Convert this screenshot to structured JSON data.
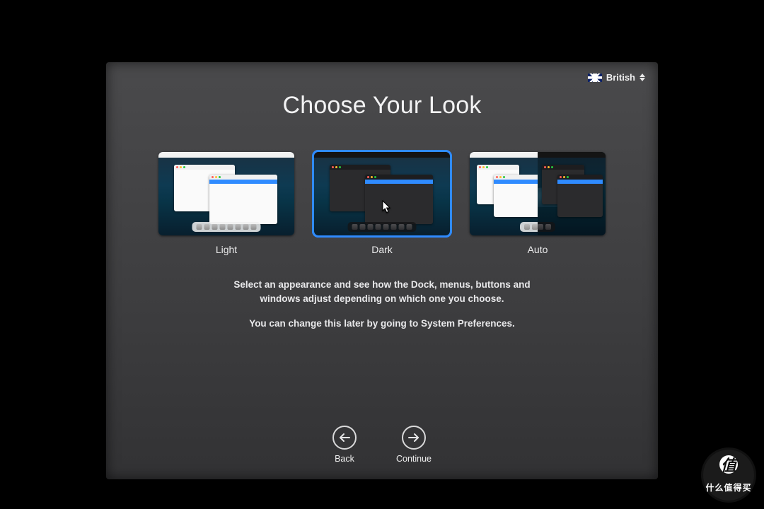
{
  "lang": {
    "label": "British"
  },
  "title": "Choose Your Look",
  "options": [
    {
      "label": "Light",
      "selected": false
    },
    {
      "label": "Dark",
      "selected": true
    },
    {
      "label": "Auto",
      "selected": false
    }
  ],
  "description": {
    "line1": "Select an appearance and see how the Dock, menus, buttons and windows adjust depending on which one you choose.",
    "line2": "You can change this later by going to System Preferences."
  },
  "nav": {
    "back": "Back",
    "continue": "Continue"
  },
  "watermark": {
    "badge": "值",
    "text": "什么值得买"
  }
}
